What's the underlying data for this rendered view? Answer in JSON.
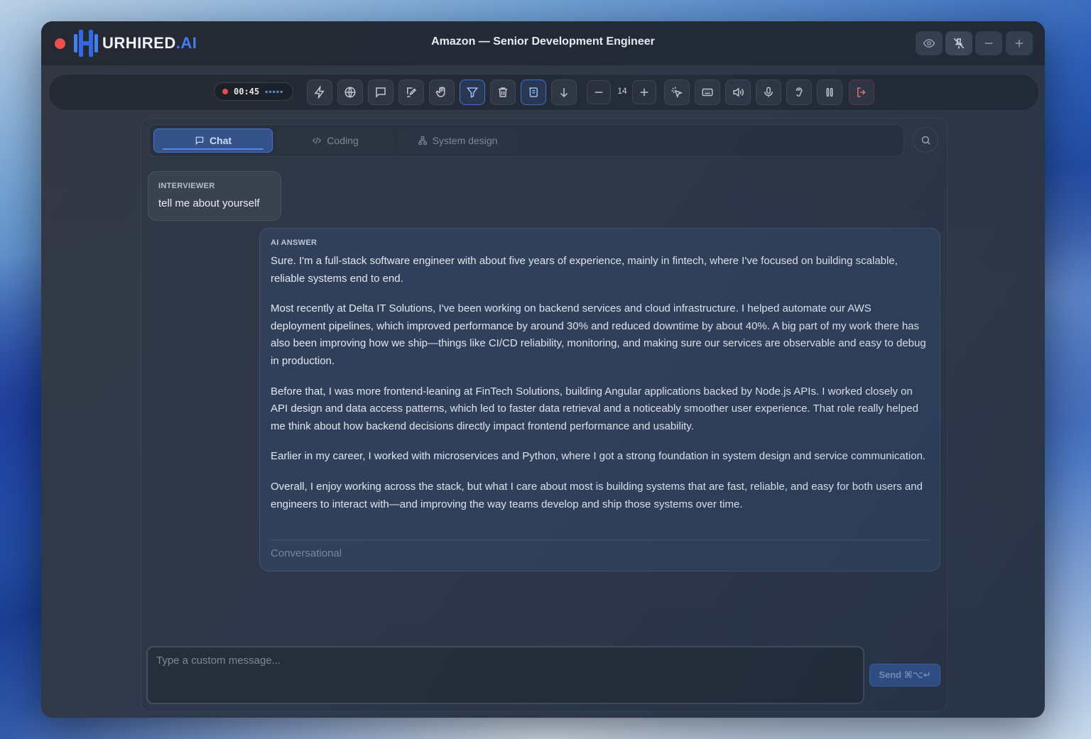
{
  "app": {
    "logo": {
      "text_main": "URHIRED",
      "text_accent": ".AI"
    },
    "window_title": "Amazon — Senior Development Engineer",
    "window_controls": [
      "eye-icon",
      "pin-off-icon",
      "minimize-icon",
      "plus-icon"
    ]
  },
  "toolbar": {
    "timer": "00:45",
    "wave": "▪▪▪▪▪",
    "zoom_value": "14",
    "buttons": [
      "bolt-icon",
      "globe-icon",
      "chat-icon",
      "edit-icon",
      "hand-icon",
      "filter-icon",
      "trash-icon",
      "scroll-icon",
      "arrow-down-icon",
      "zoom-out-icon",
      "zoom-in-icon",
      "cursor-click-icon",
      "keyboard-icon",
      "speaker-icon",
      "mic-icon",
      "ear-icon",
      "pause-icon",
      "exit-icon"
    ]
  },
  "tabs": [
    {
      "label": "Chat",
      "active": true
    },
    {
      "label": "Coding",
      "active": false
    },
    {
      "label": "System design",
      "active": false
    }
  ],
  "conversation": {
    "question": {
      "label": "INTERVIEWER",
      "text": "tell me about yourself"
    },
    "answer": {
      "label": "AI ANSWER",
      "paragraphs": [
        "Sure. I'm a full-stack software engineer with about five years of experience, mainly in fintech, where I've focused on building scalable, reliable systems end to end.",
        "Most recently at Delta IT Solutions, I've been working on backend services and cloud infrastructure. I helped automate our AWS deployment pipelines, which improved performance by around 30% and reduced downtime by about 40%. A big part of my work there has also been improving how we ship—things like CI/CD reliability, monitoring, and making sure our services are observable and easy to debug in production.",
        "Before that, I was more frontend-leaning at FinTech Solutions, building Angular applications backed by Node.js APIs. I worked closely on API design and data access patterns, which led to faster data retrieval and a noticeably smoother user experience. That role really helped me think about how backend decisions directly impact frontend performance and usability.",
        "Earlier in my career, I worked with microservices and Python, where I got a strong foundation in system design and service communication.",
        "Overall, I enjoy working across the stack, but what I care about most is building systems that are fast, reliable, and easy for both users and engineers to interact with—and improving the way teams develop and ship those systems over time."
      ],
      "style": "Conversational"
    }
  },
  "composer": {
    "placeholder": "Type a custom message...",
    "send_label": "Send ⌘⌥↵"
  },
  "colors": {
    "accent": "#3a7cf0",
    "record": "#e24a4a",
    "danger": "#ff6a6a"
  }
}
